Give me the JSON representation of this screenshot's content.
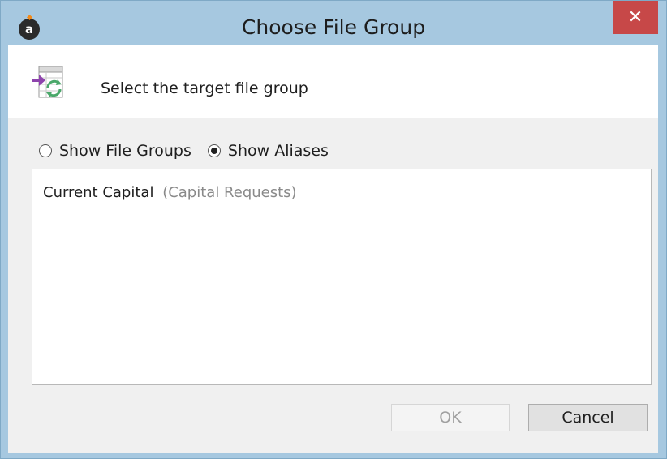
{
  "window": {
    "title": "Choose File Group",
    "app_icon_letter": "a",
    "close_glyph": "✕"
  },
  "header": {
    "icon": "file-group-sync-icon",
    "instruction": "Select the target file group"
  },
  "view_options": {
    "show_file_groups_label": "Show File Groups",
    "show_aliases_label": "Show Aliases",
    "selected": "Show Aliases"
  },
  "list": {
    "items": [
      {
        "name": "Current Capital",
        "detail": "(Capital Requests)"
      }
    ]
  },
  "buttons": {
    "ok_label": "OK",
    "ok_enabled": false,
    "cancel_label": "Cancel"
  },
  "colors": {
    "titlebar": "#a6c8e0",
    "close_button": "#c74848",
    "accent_purple": "#8e44ad",
    "accent_green": "#4aa86a"
  }
}
